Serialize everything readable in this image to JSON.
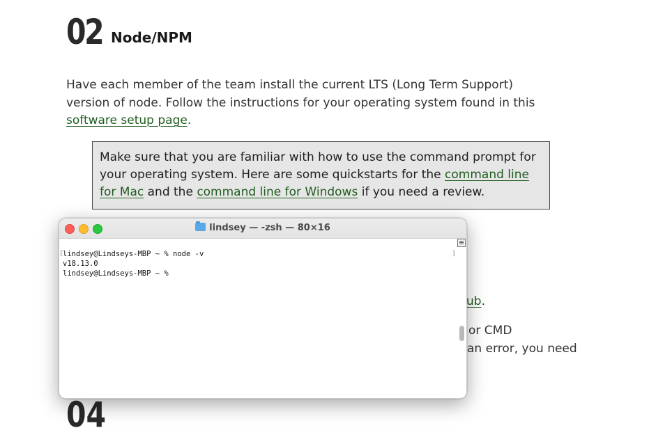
{
  "section": {
    "number": "02",
    "title": "Node/NPM",
    "intro_text_1": "Have each member of the team install the current LTS (Long Term Support) version of node. Follow the instructions for your operating system found in this ",
    "intro_link": "software setup page",
    "intro_text_2": "."
  },
  "callout": {
    "text_1": "Make sure that you are familiar with how to use the command prompt for your operating system. Here are some quickstarts for the ",
    "link_mac": "command line for Mac",
    "text_2": " and the ",
    "link_windows": "command line for Windows",
    "text_3": " if you need a review."
  },
  "partially_hidden": {
    "link_fragment": "ub",
    "after_link": ".",
    "line_1": "or CMD",
    "line_2": "an error, you need"
  },
  "next_section": {
    "number": "04"
  },
  "terminal": {
    "title": "lindsey — -zsh — 80×16",
    "lines": [
      "lindsey@Lindseys-MBP ~ % node -v",
      "v18.13.0",
      "lindsey@Lindseys-MBP ~ % "
    ]
  }
}
